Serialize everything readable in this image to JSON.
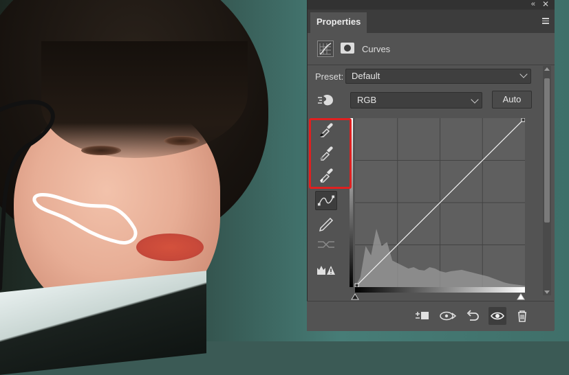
{
  "panel": {
    "tab_label": "Properties",
    "adjustment_title": "Curves",
    "preset": {
      "label": "Preset:",
      "value": "Default"
    },
    "channel": {
      "value": "RGB"
    },
    "auto_label": "Auto"
  },
  "icons": {
    "collapse": "collapse-panels-icon",
    "close": "close-icon",
    "panel_menu": "panel-menu-icon",
    "adjustment": "curves-adjustment-icon",
    "mask": "layer-mask-icon",
    "targeted_adjustment": "targeted-adjustment-tool-icon",
    "eyedroppers": [
      "black-point-eyedropper-icon",
      "gray-point-eyedropper-icon",
      "white-point-eyedropper-icon"
    ],
    "tools": [
      "edit-points-curve-icon",
      "draw-pencil-icon",
      "smooth-curve-icon",
      "clipping-warning-icon"
    ],
    "bottom": [
      "clip-to-layer-icon",
      "view-previous-state-icon",
      "reset-icon",
      "toggle-visibility-icon",
      "delete-icon"
    ]
  },
  "colors": {
    "panel_bg": "#535353",
    "highlight_box": "#e02020",
    "annotation_stroke": "#ffffff"
  },
  "chart_data": {
    "type": "area",
    "x": [
      0,
      8,
      16,
      24,
      32,
      40,
      48,
      56,
      64,
      72,
      80,
      88,
      96,
      104,
      112,
      120,
      128,
      136,
      144,
      152,
      160,
      168,
      176,
      184,
      192,
      200,
      208,
      216,
      224,
      232,
      240,
      248,
      255
    ],
    "values": [
      0,
      15,
      62,
      48,
      88,
      62,
      68,
      40,
      36,
      32,
      28,
      30,
      26,
      25,
      30,
      28,
      24,
      22,
      24,
      25,
      26,
      24,
      22,
      20,
      18,
      16,
      13,
      10,
      7,
      5,
      4,
      3,
      2
    ],
    "curve_points": [
      [
        0,
        0
      ],
      [
        255,
        255
      ]
    ],
    "xlim": [
      0,
      255
    ],
    "ylim": [
      0,
      255
    ],
    "grid": true
  }
}
